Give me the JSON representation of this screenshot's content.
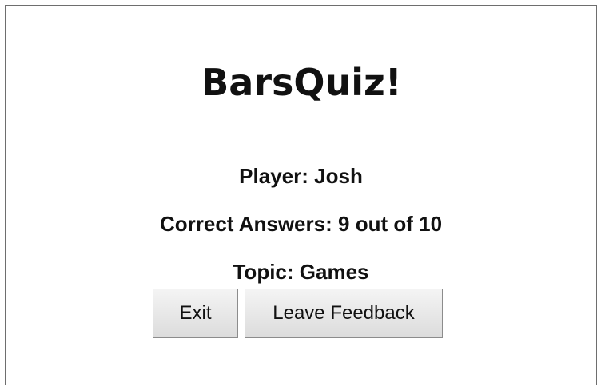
{
  "app": {
    "logo_text": "BarsQuiz!"
  },
  "results": {
    "player_label": "Player:",
    "player_name": "Josh",
    "correct_label": "Correct Answers:",
    "correct_count": "9",
    "out_of_text": "out of",
    "total_questions": "10",
    "topic_label": "Topic:",
    "topic_name": "Games"
  },
  "buttons": {
    "exit_label": "Exit",
    "feedback_label": "Leave Feedback"
  },
  "colors": {
    "text": "#111111",
    "button_border": "#8c8c8c",
    "button_top": "#f4f4f4",
    "button_bottom": "#dcdcdc",
    "frame_border": "#6e6e6e"
  }
}
